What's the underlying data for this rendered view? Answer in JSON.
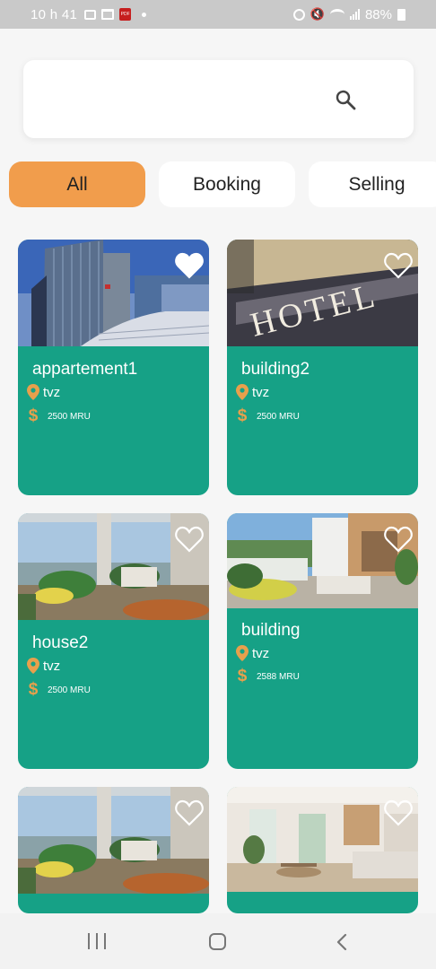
{
  "status_bar": {
    "time": "10 h 41",
    "battery": "88%"
  },
  "search": {
    "icon": "search-icon"
  },
  "categories": [
    {
      "label": "All",
      "active": true
    },
    {
      "label": "Booking",
      "active": false
    },
    {
      "label": "Selling",
      "active": false
    }
  ],
  "colors": {
    "accent": "#f19d4c",
    "card_bg": "#16a186",
    "pin": "#e8a04c"
  },
  "listings": [
    {
      "title": "appartement1",
      "location": "tvz",
      "price": "2500 MRU",
      "favorite": true
    },
    {
      "title": "building2",
      "location": "tvz",
      "price": "2500 MRU",
      "favorite": false
    },
    {
      "title": "house2",
      "location": "tvz",
      "price": "2500 MRU",
      "favorite": false
    },
    {
      "title": "building",
      "location": "tvz",
      "price": "2588 MRU",
      "favorite": false
    },
    {
      "title": "",
      "location": "",
      "price": "",
      "favorite": false
    },
    {
      "title": "",
      "location": "",
      "price": "",
      "favorite": false
    }
  ]
}
